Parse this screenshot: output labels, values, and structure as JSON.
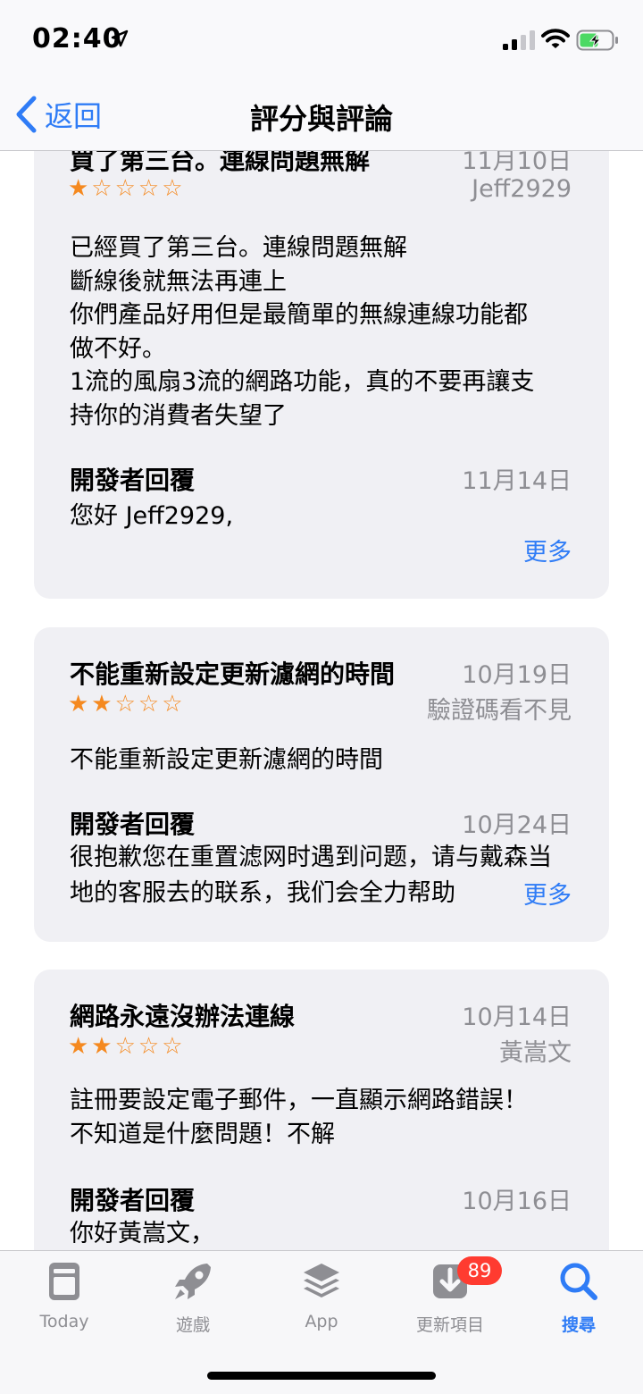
{
  "status_bar": {
    "time": "02:40"
  },
  "nav": {
    "back_label": "返回",
    "title": "評分與評論"
  },
  "reviews": [
    {
      "title": "買了第三台。連線問題無解",
      "date": "11月10日",
      "author": "Jeff2929",
      "rating": 1,
      "stars": "★☆☆☆☆",
      "body": [
        "已經買了第三台。連線問題無解",
        "斷線後就無法再連上",
        "你們產品好用但是最簡單的無線連線功能都",
        "做不好。",
        "1流的風扇3流的網路功能，真的不要再讓支",
        "持你的消費者失望了"
      ],
      "reply_label": "開發者回覆",
      "reply_date": "11月14日",
      "reply_text": "您好 Jeff2929,",
      "more": "更多"
    },
    {
      "title": "不能重新設定更新濾網的時間",
      "date": "10月19日",
      "author": "驗證碼看不見",
      "rating": 2,
      "stars": "★★☆☆☆",
      "body": [
        "不能重新設定更新濾網的時間"
      ],
      "reply_label": "開發者回覆",
      "reply_date": "10月24日",
      "reply_text": "很抱歉您在重置滤网时遇到问题，请与戴森当地的客服去的联系，我们会全力帮助",
      "more": "更多"
    },
    {
      "title": "網路永遠沒辦法連線",
      "date": "10月14日",
      "author": "黃嵩文",
      "rating": 2,
      "stars": "★★☆☆☆",
      "body": [
        "註冊要設定電子郵件，一直顯示網路錯誤！",
        "不知道是什麼問題！不解"
      ],
      "reply_label": "開發者回覆",
      "reply_date": "10月16日",
      "reply_text": "你好黃嵩文，"
    }
  ],
  "tabs": [
    {
      "label": "Today",
      "icon": "today-icon"
    },
    {
      "label": "遊戲",
      "icon": "rocket-icon"
    },
    {
      "label": "App",
      "icon": "layers-icon"
    },
    {
      "label": "更新項目",
      "icon": "download-icon",
      "badge": "89"
    },
    {
      "label": "搜尋",
      "icon": "search-icon",
      "active": true
    }
  ],
  "colors": {
    "accent": "#2f7cf6",
    "star": "#f5891f",
    "badge": "#ff3b30",
    "card": "#f0f0f4"
  }
}
